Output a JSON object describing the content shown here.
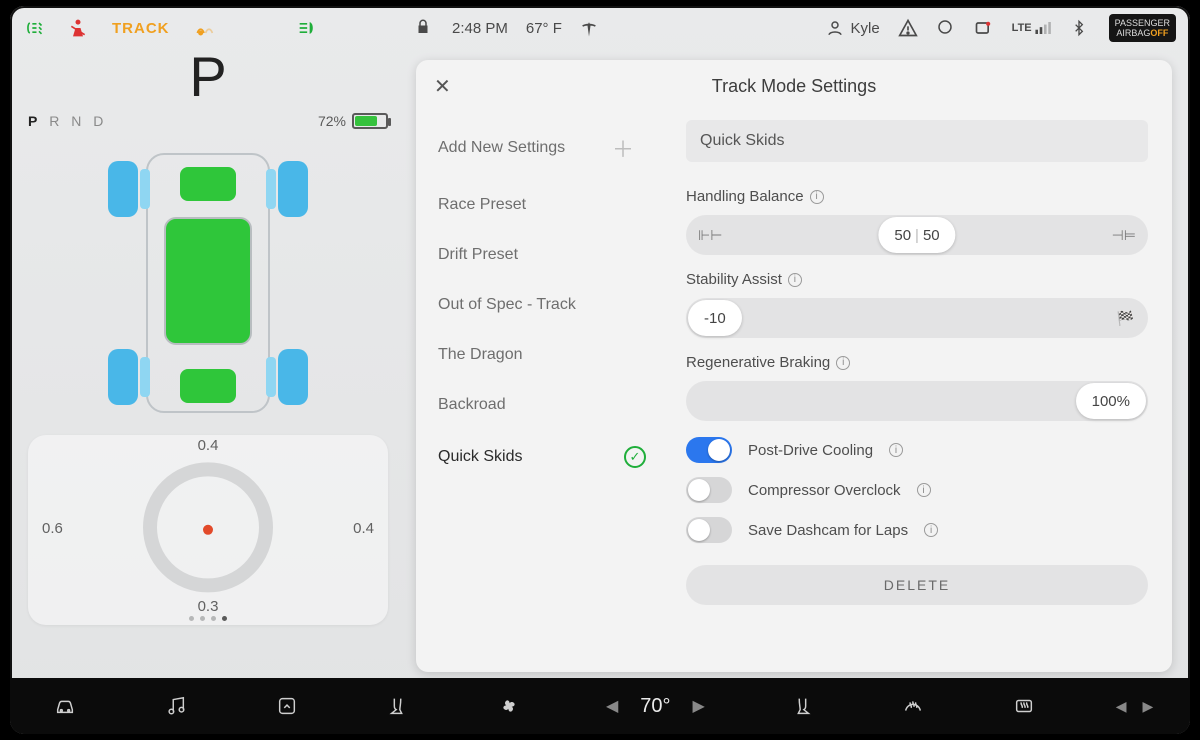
{
  "status": {
    "track_label": "TRACK",
    "time": "2:48 PM",
    "outside_temp": "67° F",
    "user": "Kyle",
    "signal": "LTE",
    "airbag_line1": "PASSENGER",
    "airbag_line2": "AIRBAG",
    "airbag_off": "OFF"
  },
  "drive": {
    "gear": "P",
    "gears": [
      "P",
      "R",
      "N",
      "D"
    ],
    "battery_pct": "72%",
    "g": {
      "top": "0.4",
      "left": "0.6",
      "right": "0.4",
      "bottom": "0.3"
    }
  },
  "settings": {
    "title": "Track Mode Settings",
    "add_new": "Add New Settings",
    "presets": [
      "Race Preset",
      "Drift Preset",
      "Out of Spec - Track",
      "The Dragon",
      "Backroad",
      "Quick Skids"
    ],
    "selected_name": "Quick Skids",
    "handling_label": "Handling Balance",
    "handling_front": "50",
    "handling_rear": "50",
    "stability_label": "Stability Assist",
    "stability_value": "-10",
    "regen_label": "Regenerative Braking",
    "regen_value": "100%",
    "toggles": {
      "cooling": "Post-Drive Cooling",
      "compressor": "Compressor Overclock",
      "dashcam": "Save Dashcam for Laps"
    },
    "delete": "DELETE"
  },
  "dock": {
    "cabin_temp": "70°"
  }
}
